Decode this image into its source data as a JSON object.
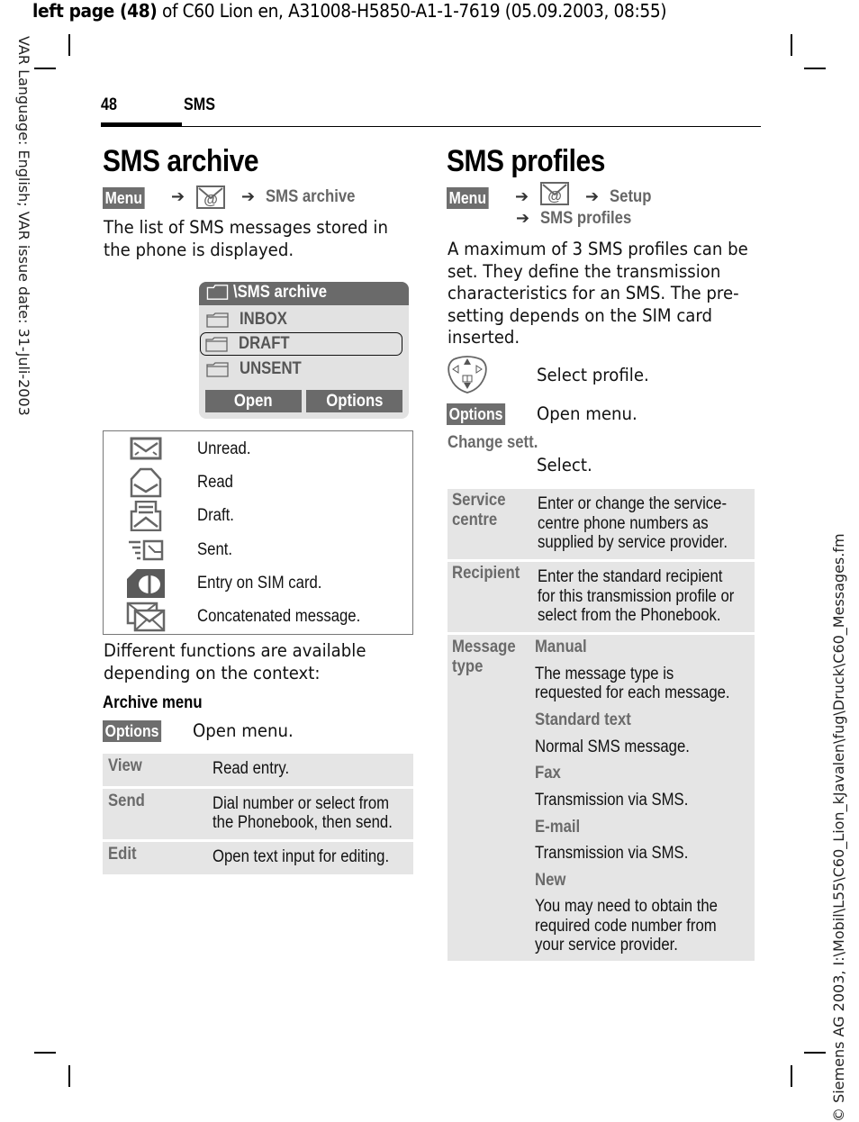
{
  "print_header": {
    "bold_part": "left page (48)",
    "rest": " of C60 Lion en, A31008-H5850-A1-1-7619 (05.09.2003, 08:55)"
  },
  "side_text": {
    "left": "VAR Language: English; VAR issue date: 31-Juli-2003",
    "right": "© Siemens AG 2003, I:\\Mobil\\L55\\C60_Lion_kJavalen\\fug\\Druck\\C60_Messages.fm"
  },
  "page_header": {
    "page_number": "48",
    "section": "SMS"
  },
  "left_column": {
    "title": "SMS archive",
    "nav": {
      "softkey": "Menu",
      "arrow": "➔",
      "icon": "messages-at-icon",
      "target": "SMS archive"
    },
    "intro": [
      "The list of SMS messages stored in",
      "the phone is displayed."
    ],
    "phone_screen": {
      "title": "\\SMS archive",
      "items": [
        {
          "label": "INBOX",
          "selected": false
        },
        {
          "label": "DRAFT",
          "selected": true
        },
        {
          "label": "UNSENT",
          "selected": false
        }
      ],
      "buttons": [
        "Open",
        "Options"
      ]
    },
    "icon_legend": [
      {
        "icon": "unread-envelope-icon",
        "label": "Unread."
      },
      {
        "icon": "read-envelope-icon",
        "label": "Read"
      },
      {
        "icon": "draft-icon",
        "label": "Draft."
      },
      {
        "icon": "sent-icon",
        "label": "Sent."
      },
      {
        "icon": "sim-card-icon",
        "label": "Entry on SIM card."
      },
      {
        "icon": "concatenated-message-icon",
        "label": "Concatenated message."
      }
    ],
    "functions_text": [
      "Different functions are available",
      "depending on the context:"
    ],
    "archive_menu": {
      "heading": "Archive menu",
      "softkey": "Options",
      "action": "Open menu.",
      "options": [
        {
          "key": "View",
          "value": [
            "Read entry."
          ]
        },
        {
          "key": "Send",
          "value": [
            "Dial number or select from",
            "the Phonebook, then send."
          ]
        },
        {
          "key": "Edit",
          "value": [
            "Open text input for editing."
          ]
        }
      ]
    }
  },
  "right_column": {
    "title": "SMS profiles",
    "nav": {
      "softkey": "Menu",
      "arrow": "➔",
      "icon": "messages-at-icon",
      "step1": "Setup",
      "step2": "SMS profiles"
    },
    "intro": [
      "A maximum of 3 SMS profiles can be",
      "set. They define the transmission",
      "characteristics for an SMS. The pre-",
      "setting depends on the SIM card",
      "inserted."
    ],
    "steps": [
      {
        "icon": "navigation-key-icon",
        "text": "Select profile."
      },
      {
        "softkey": "Options",
        "text": "Open menu."
      }
    ],
    "change_settings": {
      "label": "Change sett.",
      "text": "Select."
    },
    "settings": [
      {
        "key": [
          "Service",
          "centre"
        ],
        "value": [
          "Enter or change the service-",
          "centre phone numbers as",
          "supplied by service provider."
        ]
      },
      {
        "key": [
          "Recipient"
        ],
        "value": [
          "Enter the standard recipient",
          "for this transmission profile or",
          "select from the Phonebook."
        ]
      },
      {
        "key": [
          "Message",
          "type"
        ],
        "subitems": [
          {
            "name": "Manual",
            "desc": [
              "The message type is",
              "requested for each message."
            ]
          },
          {
            "name": "Standard text",
            "desc": [
              "Normal SMS message."
            ]
          },
          {
            "name": "Fax",
            "desc": [
              "Transmission via SMS."
            ]
          },
          {
            "name": "E-mail",
            "desc": [
              "Transmission via SMS."
            ]
          },
          {
            "name": "New",
            "desc": [
              "You may need to obtain the",
              "required code number from",
              "your service provider."
            ]
          }
        ]
      }
    ]
  },
  "colors": {
    "softkey_bg": "#6e6e6e",
    "label_gray": "#6a6a6a",
    "table_bg": "#e5e5e5",
    "phone_bg": "#e2e2e2"
  }
}
